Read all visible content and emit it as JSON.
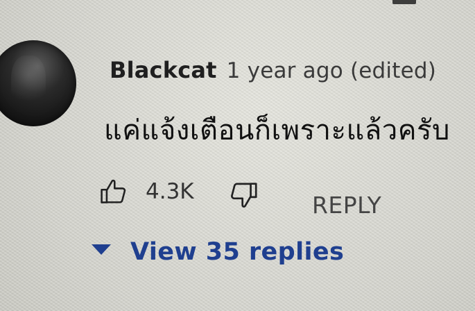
{
  "comment": {
    "author": "Blackcat",
    "timestamp": "1 year ago (edited)",
    "text": "แค่แจ้งเตือนก็เพราะแล้วครับ",
    "likes": "4.3K"
  },
  "actions": {
    "reply_label": "REPLY",
    "like_icon": "thumbs-up-icon",
    "dislike_icon": "thumbs-down-icon"
  },
  "replies": {
    "label": "View 35 replies",
    "accent_color": "#1f3f8f"
  }
}
